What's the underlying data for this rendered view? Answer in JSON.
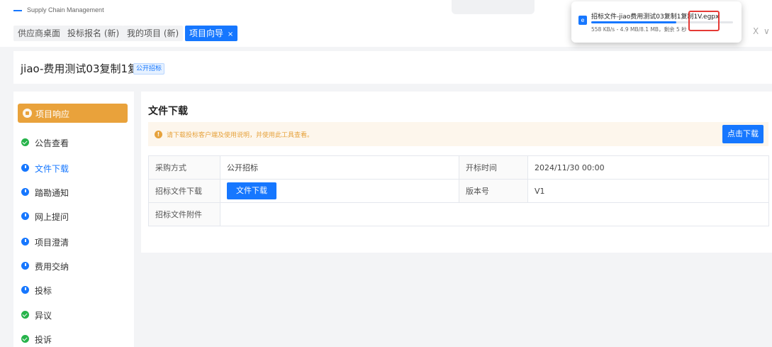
{
  "app": {
    "subtitle": "Supply Chain Management"
  },
  "tabs": [
    {
      "label": "供应商桌面"
    },
    {
      "label": "投标报名 (新)"
    },
    {
      "label": "我的项目 (新)"
    },
    {
      "label": "项目向导",
      "close": "×"
    }
  ],
  "window_controls": {
    "close": "X",
    "more": "∨"
  },
  "download": {
    "filename": "招标文件-jiao费用测试03复制1复制1V",
    "extension": ".egpx",
    "status": "558 KB/s - 4.9 MB/8.1 MB，剩余 5 秒",
    "progress": 0.6
  },
  "project": {
    "title": "jiao-费用测试03复制1复制1",
    "badge": "公开招标"
  },
  "sidebar": {
    "active": "项目响应",
    "items": [
      {
        "label": "公告查看",
        "status": "done"
      },
      {
        "label": "文件下载",
        "status": "current"
      },
      {
        "label": "踏勘通知",
        "status": "pending"
      },
      {
        "label": "网上提问",
        "status": "pending"
      },
      {
        "label": "项目澄清",
        "status": "pending"
      },
      {
        "label": "费用交纳",
        "status": "pending"
      },
      {
        "label": "投标",
        "status": "pending"
      },
      {
        "label": "异议",
        "status": "done"
      },
      {
        "label": "投诉",
        "status": "done"
      }
    ]
  },
  "main": {
    "section_title": "文件下载",
    "alert": {
      "message": "请下载投标客户端及使用说明，并使用此工具查看。",
      "icon": "!",
      "button": "点击下载"
    },
    "table": {
      "row1": {
        "l1": "采购方式",
        "v1": "公开招标",
        "l2": "开标时间",
        "v2": "2024/11/30 00:00"
      },
      "row2": {
        "l1": "招标文件下载",
        "button": "文件下载",
        "l2": "版本号",
        "v2": "V1"
      },
      "row3": {
        "l1": "招标文件附件",
        "v1": ""
      }
    }
  },
  "colors": {
    "accent": "#1677ff",
    "active_nav": "#e9a23b",
    "done": "#26b34a",
    "warning": "#e6a23c",
    "highlight": "#e53935"
  }
}
